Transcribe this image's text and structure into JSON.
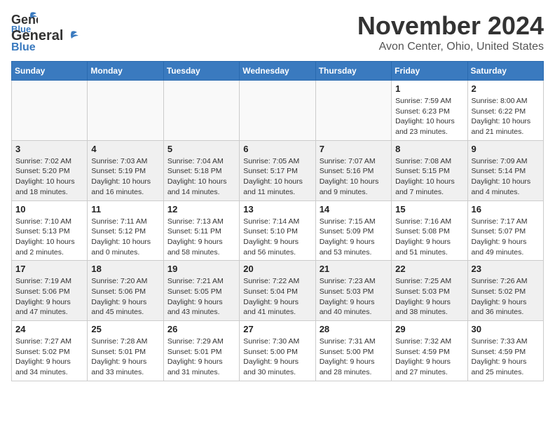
{
  "header": {
    "logo_line1": "General",
    "logo_line2": "Blue",
    "month_year": "November 2024",
    "location": "Avon Center, Ohio, United States"
  },
  "weekdays": [
    "Sunday",
    "Monday",
    "Tuesday",
    "Wednesday",
    "Thursday",
    "Friday",
    "Saturday"
  ],
  "weeks": [
    [
      {
        "day": "",
        "info": ""
      },
      {
        "day": "",
        "info": ""
      },
      {
        "day": "",
        "info": ""
      },
      {
        "day": "",
        "info": ""
      },
      {
        "day": "",
        "info": ""
      },
      {
        "day": "1",
        "info": "Sunrise: 7:59 AM\nSunset: 6:23 PM\nDaylight: 10 hours\nand 23 minutes."
      },
      {
        "day": "2",
        "info": "Sunrise: 8:00 AM\nSunset: 6:22 PM\nDaylight: 10 hours\nand 21 minutes."
      }
    ],
    [
      {
        "day": "3",
        "info": "Sunrise: 7:02 AM\nSunset: 5:20 PM\nDaylight: 10 hours\nand 18 minutes."
      },
      {
        "day": "4",
        "info": "Sunrise: 7:03 AM\nSunset: 5:19 PM\nDaylight: 10 hours\nand 16 minutes."
      },
      {
        "day": "5",
        "info": "Sunrise: 7:04 AM\nSunset: 5:18 PM\nDaylight: 10 hours\nand 14 minutes."
      },
      {
        "day": "6",
        "info": "Sunrise: 7:05 AM\nSunset: 5:17 PM\nDaylight: 10 hours\nand 11 minutes."
      },
      {
        "day": "7",
        "info": "Sunrise: 7:07 AM\nSunset: 5:16 PM\nDaylight: 10 hours\nand 9 minutes."
      },
      {
        "day": "8",
        "info": "Sunrise: 7:08 AM\nSunset: 5:15 PM\nDaylight: 10 hours\nand 7 minutes."
      },
      {
        "day": "9",
        "info": "Sunrise: 7:09 AM\nSunset: 5:14 PM\nDaylight: 10 hours\nand 4 minutes."
      }
    ],
    [
      {
        "day": "10",
        "info": "Sunrise: 7:10 AM\nSunset: 5:13 PM\nDaylight: 10 hours\nand 2 minutes."
      },
      {
        "day": "11",
        "info": "Sunrise: 7:11 AM\nSunset: 5:12 PM\nDaylight: 10 hours\nand 0 minutes."
      },
      {
        "day": "12",
        "info": "Sunrise: 7:13 AM\nSunset: 5:11 PM\nDaylight: 9 hours\nand 58 minutes."
      },
      {
        "day": "13",
        "info": "Sunrise: 7:14 AM\nSunset: 5:10 PM\nDaylight: 9 hours\nand 56 minutes."
      },
      {
        "day": "14",
        "info": "Sunrise: 7:15 AM\nSunset: 5:09 PM\nDaylight: 9 hours\nand 53 minutes."
      },
      {
        "day": "15",
        "info": "Sunrise: 7:16 AM\nSunset: 5:08 PM\nDaylight: 9 hours\nand 51 minutes."
      },
      {
        "day": "16",
        "info": "Sunrise: 7:17 AM\nSunset: 5:07 PM\nDaylight: 9 hours\nand 49 minutes."
      }
    ],
    [
      {
        "day": "17",
        "info": "Sunrise: 7:19 AM\nSunset: 5:06 PM\nDaylight: 9 hours\nand 47 minutes."
      },
      {
        "day": "18",
        "info": "Sunrise: 7:20 AM\nSunset: 5:06 PM\nDaylight: 9 hours\nand 45 minutes."
      },
      {
        "day": "19",
        "info": "Sunrise: 7:21 AM\nSunset: 5:05 PM\nDaylight: 9 hours\nand 43 minutes."
      },
      {
        "day": "20",
        "info": "Sunrise: 7:22 AM\nSunset: 5:04 PM\nDaylight: 9 hours\nand 41 minutes."
      },
      {
        "day": "21",
        "info": "Sunrise: 7:23 AM\nSunset: 5:03 PM\nDaylight: 9 hours\nand 40 minutes."
      },
      {
        "day": "22",
        "info": "Sunrise: 7:25 AM\nSunset: 5:03 PM\nDaylight: 9 hours\nand 38 minutes."
      },
      {
        "day": "23",
        "info": "Sunrise: 7:26 AM\nSunset: 5:02 PM\nDaylight: 9 hours\nand 36 minutes."
      }
    ],
    [
      {
        "day": "24",
        "info": "Sunrise: 7:27 AM\nSunset: 5:02 PM\nDaylight: 9 hours\nand 34 minutes."
      },
      {
        "day": "25",
        "info": "Sunrise: 7:28 AM\nSunset: 5:01 PM\nDaylight: 9 hours\nand 33 minutes."
      },
      {
        "day": "26",
        "info": "Sunrise: 7:29 AM\nSunset: 5:01 PM\nDaylight: 9 hours\nand 31 minutes."
      },
      {
        "day": "27",
        "info": "Sunrise: 7:30 AM\nSunset: 5:00 PM\nDaylight: 9 hours\nand 30 minutes."
      },
      {
        "day": "28",
        "info": "Sunrise: 7:31 AM\nSunset: 5:00 PM\nDaylight: 9 hours\nand 28 minutes."
      },
      {
        "day": "29",
        "info": "Sunrise: 7:32 AM\nSunset: 4:59 PM\nDaylight: 9 hours\nand 27 minutes."
      },
      {
        "day": "30",
        "info": "Sunrise: 7:33 AM\nSunset: 4:59 PM\nDaylight: 9 hours\nand 25 minutes."
      }
    ]
  ]
}
